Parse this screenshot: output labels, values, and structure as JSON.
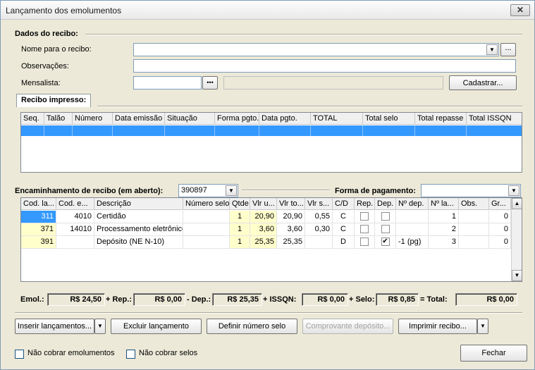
{
  "window": {
    "title": "Lançamento dos emolumentos",
    "close_glyph": "✕"
  },
  "recibo": {
    "section_title": "Dados do recibo:",
    "nome_label": "Nome para o recibo:",
    "nome_value": "",
    "nome_ellipsis": "...",
    "obs_label": "Observações:",
    "obs_value": "",
    "mensalista_label": "Mensalista:",
    "mensalista_value": "",
    "mensalista_dots": "•••",
    "cadastrar_label": "Cadastrar..."
  },
  "impresso": {
    "tab_label": "Recibo impresso:",
    "columns": [
      "Seq.",
      "Talão",
      "Número",
      "Data emissão",
      "Situação",
      "Forma pgto.",
      "Data pgto.",
      "TOTAL",
      "Total selo",
      "Total repasse",
      "Total ISSQN"
    ]
  },
  "encaminhamento": {
    "label": "Encaminhamento de recibo (em aberto):",
    "value": "390897",
    "forma_label": "Forma de pagamento:",
    "forma_value": ""
  },
  "lanc": {
    "columns": [
      "Cod. la...",
      "Cod. e...",
      "Descrição",
      "Número selo",
      "Qtde",
      "Vlr u...",
      "Vlr to...",
      "Vlr s...",
      "C/D",
      "Rep.",
      "Dep.",
      "Nº dep.",
      "Nº la...",
      "Obs.",
      "Gr..."
    ],
    "rows": [
      {
        "cod_lanc": "311",
        "cod_e": "4010",
        "descricao": "Certidão",
        "numero_selo": "",
        "qtde": "1",
        "vlr_unit": "20,90",
        "vlr_total": "20,90",
        "vlr_selo": "0,55",
        "cd": "C",
        "rep": false,
        "dep": false,
        "n_dep": "",
        "n_lanc": "1",
        "obs": "",
        "gr": "0"
      },
      {
        "cod_lanc": "371",
        "cod_e": "14010",
        "descricao": "Processamento eletrônico",
        "numero_selo": "",
        "qtde": "1",
        "vlr_unit": "3,60",
        "vlr_total": "3,60",
        "vlr_selo": "0,30",
        "cd": "C",
        "rep": false,
        "dep": false,
        "n_dep": "",
        "n_lanc": "2",
        "obs": "",
        "gr": "0"
      },
      {
        "cod_lanc": "391",
        "cod_e": "",
        "descricao": "Depósito (NE N-10)",
        "numero_selo": "",
        "qtde": "1",
        "vlr_unit": "25,35",
        "vlr_total": "25,35",
        "vlr_selo": "",
        "cd": "D",
        "rep": false,
        "dep": true,
        "n_dep": "-1 (pg)",
        "n_lanc": "3",
        "obs": "",
        "gr": "0"
      }
    ]
  },
  "totals": {
    "emol_label": "Emol.:",
    "emol_value": "R$ 24,50",
    "rep_label": "+ Rep.:",
    "rep_value": "R$ 0,00",
    "dep_label": "- Dep.:",
    "dep_value": "R$ 25,35",
    "issqn_label": "+ ISSQN:",
    "issqn_value": "R$ 0,00",
    "selo_label": "+ Selo:",
    "selo_value": "R$ 0,85",
    "total_label": "= Total:",
    "total_value": "R$ 0,00"
  },
  "actions": {
    "inserir": "Inserir lançamentos...",
    "excluir": "Excluir lançamento",
    "definir": "Definir número selo",
    "comprovante": "Comprovante depósito...",
    "imprimir": "Imprimir recibo..."
  },
  "footer": {
    "nao_cobrar_emol": "Não cobrar emolumentos",
    "nao_cobrar_selos": "Não cobrar selos",
    "fechar": "Fechar"
  },
  "icons": {
    "dropdown": "▼",
    "scroll_up": "▲",
    "scroll_down": "▼",
    "check": "✔"
  }
}
